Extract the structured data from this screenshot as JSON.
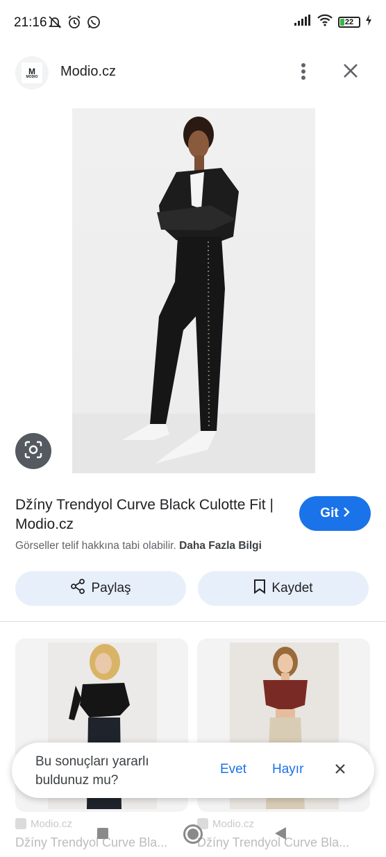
{
  "status_bar": {
    "time": "21:16",
    "battery": "22"
  },
  "header": {
    "site_name": "Modio.cz",
    "logo_text": "M",
    "logo_small": "MODIO"
  },
  "result": {
    "title": "Džíny Trendyol Curve Black Culotte Fit | Modio.cz",
    "go_label": "Git",
    "copyright_text": "Görseller telif hakkına tabi olabilir.",
    "more_info_label": "Daha Fazla Bilgi"
  },
  "actions": {
    "share_label": "Paylaş",
    "save_label": "Kaydet"
  },
  "related": [
    {
      "source": "Modio.cz",
      "title": "Džíny Trendyol Curve Bla..."
    },
    {
      "source": "Modio.cz",
      "title": "Džíny Trendyol Curve Bla..."
    }
  ],
  "feedback": {
    "question": "Bu sonuçları yararlı buldunuz mu?",
    "yes_label": "Evet",
    "no_label": "Hayır"
  },
  "colors": {
    "accent": "#1a73e8",
    "action_bg": "#e7effb"
  }
}
